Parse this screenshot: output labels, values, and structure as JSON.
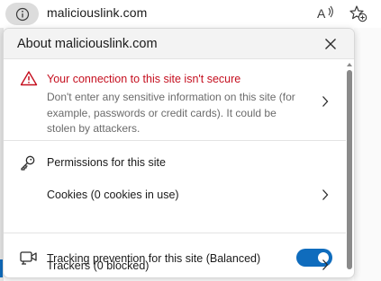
{
  "address_bar": {
    "url": "maliciouslink.com",
    "info_icon": "info-circle-icon",
    "read_aloud_icon": "read-aloud-icon",
    "favorites_icon": "add-favorite-icon"
  },
  "popup": {
    "title": "About maliciouslink.com",
    "close_icon": "close-icon",
    "warning": {
      "title": "Your connection to this site isn't secure",
      "description": "Don't enter any sensitive information on this site (for example, passwords or credit cards). It could be stolen by attackers.",
      "color": "#c50f1f"
    },
    "permissions": {
      "title": "Permissions for this site",
      "cookies_label": "Cookies (0 cookies in use)"
    },
    "tracking": {
      "title": "Tracking prevention for this site (Balanced)",
      "toggle_on": true,
      "trackers_label": "Trackers (0 blocked)"
    }
  },
  "colors": {
    "accent": "#0f6cbd",
    "warning": "#c50f1f"
  }
}
